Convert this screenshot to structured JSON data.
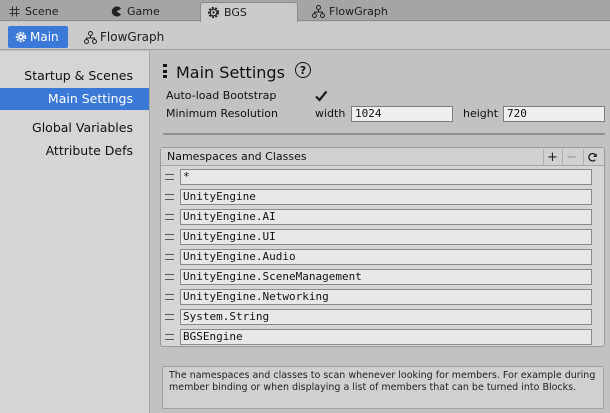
{
  "editor_tabs": [
    {
      "label": "Scene",
      "icon": "grid-icon"
    },
    {
      "label": "Game",
      "icon": "pacman-icon"
    },
    {
      "label": "BGS",
      "icon": "gear-icon",
      "active": true
    },
    {
      "label": "FlowGraph",
      "icon": "nodes-icon"
    }
  ],
  "subtabs": [
    {
      "label": "Main",
      "icon": "gear-icon",
      "active": true
    },
    {
      "label": "FlowGraph",
      "icon": "nodes-icon"
    }
  ],
  "sidebar": {
    "items": [
      {
        "label": "Startup & Scenes"
      },
      {
        "label": "Main Settings",
        "active": true
      },
      {
        "label": "Global Variables"
      },
      {
        "label": "Attribute Defs"
      }
    ]
  },
  "main": {
    "title": "Main Settings",
    "autoload_label": "Auto-load Bootstrap",
    "autoload_checked": true,
    "min_res_label": "Minimum Resolution",
    "width_label": "width",
    "width_value": "1024",
    "height_label": "height",
    "height_value": "720"
  },
  "namespaces": {
    "title": "Namespaces and Classes",
    "add_label": "+",
    "remove_label": "−",
    "items": [
      "*",
      "UnityEngine",
      "UnityEngine.AI",
      "UnityEngine.UI",
      "UnityEngine.Audio",
      "UnityEngine.SceneManagement",
      "UnityEngine.Networking",
      "System.String",
      "BGSEngine"
    ]
  },
  "help_text": "The namespaces and classes to scan whenever looking for members. For example during member binding or when displaying a list of members that can be turned into Blocks.",
  "colors": {
    "accent": "#3a79d8",
    "background": "#c2c2c2"
  }
}
